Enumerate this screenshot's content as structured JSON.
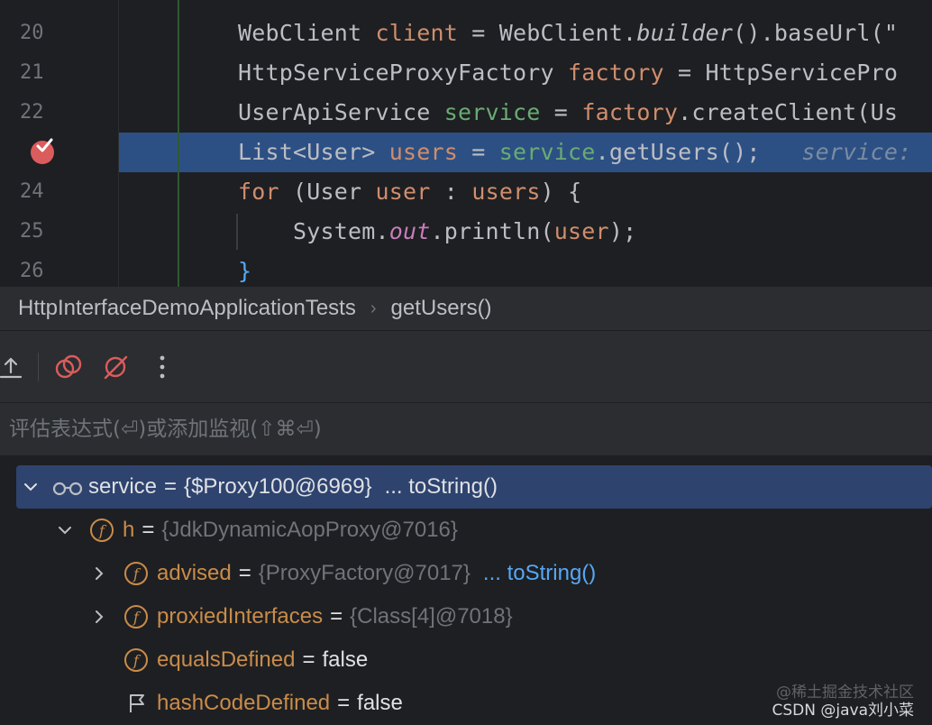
{
  "editor": {
    "lines": [
      {
        "number": "20",
        "tokens": [
          {
            "t": "WebClient ",
            "c": ""
          },
          {
            "t": "client",
            "c": "c-kw"
          },
          {
            "t": " = WebClient.",
            "c": ""
          },
          {
            "t": "builder",
            "c": "c-it"
          },
          {
            "t": "().baseUrl(\"",
            "c": ""
          }
        ]
      },
      {
        "number": "21",
        "tokens": [
          {
            "t": "HttpServiceProxyFactory ",
            "c": ""
          },
          {
            "t": "factory",
            "c": "c-kw"
          },
          {
            "t": " = HttpServicePro",
            "c": ""
          }
        ]
      },
      {
        "number": "22",
        "tokens": [
          {
            "t": "UserApiService ",
            "c": ""
          },
          {
            "t": "service",
            "c": "c-field"
          },
          {
            "t": " = ",
            "c": ""
          },
          {
            "t": "factory",
            "c": "c-kw"
          },
          {
            "t": ".createClient(Us",
            "c": ""
          }
        ]
      },
      {
        "number": "23",
        "tokens": [
          {
            "t": "List<User> ",
            "c": ""
          },
          {
            "t": "users",
            "c": "c-kw"
          },
          {
            "t": " = ",
            "c": ""
          },
          {
            "t": "service",
            "c": "c-field"
          },
          {
            "t": ".getUsers();",
            "c": ""
          },
          {
            "t": "   service:",
            "c": "c-hint"
          }
        ]
      },
      {
        "number": "24",
        "tokens": [
          {
            "t": "for",
            "c": "c-kw"
          },
          {
            "t": " (User ",
            "c": ""
          },
          {
            "t": "user",
            "c": "c-kw"
          },
          {
            "t": " : ",
            "c": ""
          },
          {
            "t": "users",
            "c": "c-kw"
          },
          {
            "t": ") {",
            "c": ""
          }
        ]
      },
      {
        "number": "25",
        "tokens": [
          {
            "t": "    System.",
            "c": ""
          },
          {
            "t": "out",
            "c": "c-static"
          },
          {
            "t": ".println(",
            "c": ""
          },
          {
            "t": "user",
            "c": "c-kw"
          },
          {
            "t": ");",
            "c": ""
          }
        ]
      },
      {
        "number": "26",
        "tokens": [
          {
            "t": "}",
            "c": "c-fn"
          }
        ]
      }
    ]
  },
  "breadcrumb": {
    "class_name": "HttpInterfaceDemoApplicationTests",
    "separator": "›",
    "method_name": "getUsers()"
  },
  "toolbar": {
    "buttons": [
      "export-icon",
      "mute-breakpoints-icon",
      "clear-breakpoints-icon",
      "more-icon"
    ]
  },
  "evaluate": {
    "placeholder": "评估表达式(⏎)或添加监视(⇧⌘⏎)"
  },
  "variables": [
    {
      "name": "service",
      "eq": "=",
      "value": "{$Proxy100@6969}",
      "link": "... toString()",
      "kind": "watch",
      "expanded": true,
      "selected": true
    },
    {
      "name": "h",
      "eq": "=",
      "value": "{JdkDynamicAopProxy@7016}",
      "link": "",
      "kind": "field",
      "expanded": true
    },
    {
      "name": "advised",
      "eq": "=",
      "value": "{ProxyFactory@7017}",
      "link": "... toString()",
      "kind": "field",
      "expanded": false
    },
    {
      "name": "proxiedInterfaces",
      "eq": "=",
      "value": "{Class[4]@7018}",
      "link": "",
      "kind": "field",
      "expanded": false
    },
    {
      "name": "equalsDefined",
      "eq": "=",
      "value": "false",
      "link": "",
      "kind": "field"
    },
    {
      "name": "hashCodeDefined",
      "eq": "=",
      "value": "false",
      "link": "",
      "kind": "flag"
    }
  ],
  "watermark": {
    "line1": "@稀土掘金技术社区",
    "line2": "CSDN @java刘小菜"
  },
  "colors": {
    "execution_line": "#2d5084",
    "selected_row": "#2e436e",
    "breakpoint": "#db5c5c",
    "field_badge": "#c98c4a",
    "link": "#56a8f5"
  }
}
